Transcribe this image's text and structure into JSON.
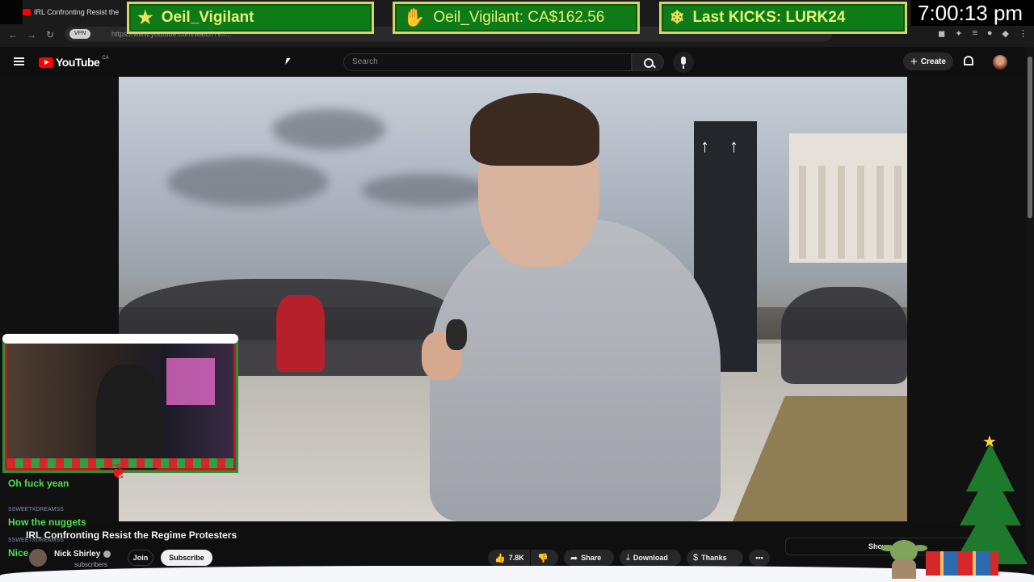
{
  "browser": {
    "tab_title": "IRL Confronting Resist the",
    "url": "https://www.youtube.com/watch?v=..."
  },
  "overlay": {
    "banner_follower": "Oeil_Vigilant",
    "banner_donation": "Oeil_Vigilant: CA$162.56",
    "banner_kicks": "Last KICKS: LURK24",
    "clock": "7:00:13 pm",
    "colors": {
      "banner_bg": "#0f7a18",
      "banner_text": "#e5f37a",
      "banner_border": "#d8d36a"
    }
  },
  "youtube": {
    "logo_text": "YouTube",
    "country": "CA",
    "search_placeholder": "Search",
    "create_label": "Create",
    "accent": "#ff0000"
  },
  "chat": [
    {
      "user": "",
      "message": "Oh fuck yean"
    },
    {
      "user": "SSWEETXDREAMSS",
      "message": "How the nuggets"
    },
    {
      "user": "SSWEETXDREAMSS",
      "message": "Nice"
    }
  ],
  "video": {
    "title": "IRL Confronting Resist the Regime Protesters",
    "channel": "Nick Shirley",
    "subscribers": "subscribers",
    "join_label": "Join",
    "subscribe_label": "Subscribe",
    "likes": "7.8K",
    "share_label": "Share",
    "download_label": "Download",
    "thanks_label": "Thanks",
    "more_label": "•••",
    "show_more_label": "Show"
  }
}
